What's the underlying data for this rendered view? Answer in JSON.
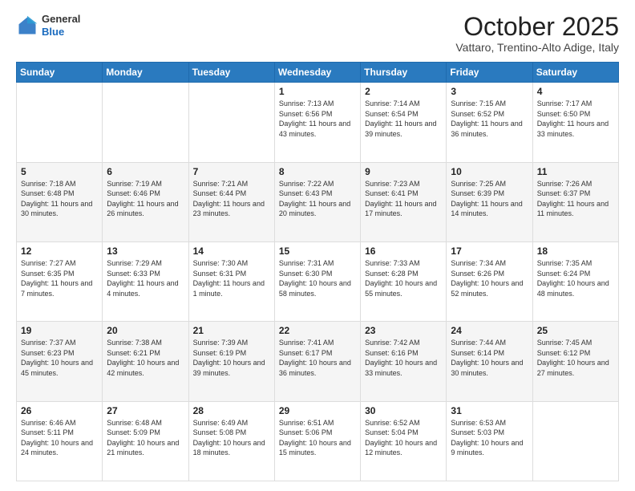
{
  "header": {
    "logo": {
      "general": "General",
      "blue": "Blue"
    },
    "month": "October 2025",
    "location": "Vattaro, Trentino-Alto Adige, Italy"
  },
  "days_of_week": [
    "Sunday",
    "Monday",
    "Tuesday",
    "Wednesday",
    "Thursday",
    "Friday",
    "Saturday"
  ],
  "weeks": [
    [
      {
        "day": "",
        "sunrise": "",
        "sunset": "",
        "daylight": ""
      },
      {
        "day": "",
        "sunrise": "",
        "sunset": "",
        "daylight": ""
      },
      {
        "day": "",
        "sunrise": "",
        "sunset": "",
        "daylight": ""
      },
      {
        "day": "1",
        "sunrise": "Sunrise: 7:13 AM",
        "sunset": "Sunset: 6:56 PM",
        "daylight": "Daylight: 11 hours and 43 minutes."
      },
      {
        "day": "2",
        "sunrise": "Sunrise: 7:14 AM",
        "sunset": "Sunset: 6:54 PM",
        "daylight": "Daylight: 11 hours and 39 minutes."
      },
      {
        "day": "3",
        "sunrise": "Sunrise: 7:15 AM",
        "sunset": "Sunset: 6:52 PM",
        "daylight": "Daylight: 11 hours and 36 minutes."
      },
      {
        "day": "4",
        "sunrise": "Sunrise: 7:17 AM",
        "sunset": "Sunset: 6:50 PM",
        "daylight": "Daylight: 11 hours and 33 minutes."
      }
    ],
    [
      {
        "day": "5",
        "sunrise": "Sunrise: 7:18 AM",
        "sunset": "Sunset: 6:48 PM",
        "daylight": "Daylight: 11 hours and 30 minutes."
      },
      {
        "day": "6",
        "sunrise": "Sunrise: 7:19 AM",
        "sunset": "Sunset: 6:46 PM",
        "daylight": "Daylight: 11 hours and 26 minutes."
      },
      {
        "day": "7",
        "sunrise": "Sunrise: 7:21 AM",
        "sunset": "Sunset: 6:44 PM",
        "daylight": "Daylight: 11 hours and 23 minutes."
      },
      {
        "day": "8",
        "sunrise": "Sunrise: 7:22 AM",
        "sunset": "Sunset: 6:43 PM",
        "daylight": "Daylight: 11 hours and 20 minutes."
      },
      {
        "day": "9",
        "sunrise": "Sunrise: 7:23 AM",
        "sunset": "Sunset: 6:41 PM",
        "daylight": "Daylight: 11 hours and 17 minutes."
      },
      {
        "day": "10",
        "sunrise": "Sunrise: 7:25 AM",
        "sunset": "Sunset: 6:39 PM",
        "daylight": "Daylight: 11 hours and 14 minutes."
      },
      {
        "day": "11",
        "sunrise": "Sunrise: 7:26 AM",
        "sunset": "Sunset: 6:37 PM",
        "daylight": "Daylight: 11 hours and 11 minutes."
      }
    ],
    [
      {
        "day": "12",
        "sunrise": "Sunrise: 7:27 AM",
        "sunset": "Sunset: 6:35 PM",
        "daylight": "Daylight: 11 hours and 7 minutes."
      },
      {
        "day": "13",
        "sunrise": "Sunrise: 7:29 AM",
        "sunset": "Sunset: 6:33 PM",
        "daylight": "Daylight: 11 hours and 4 minutes."
      },
      {
        "day": "14",
        "sunrise": "Sunrise: 7:30 AM",
        "sunset": "Sunset: 6:31 PM",
        "daylight": "Daylight: 11 hours and 1 minute."
      },
      {
        "day": "15",
        "sunrise": "Sunrise: 7:31 AM",
        "sunset": "Sunset: 6:30 PM",
        "daylight": "Daylight: 10 hours and 58 minutes."
      },
      {
        "day": "16",
        "sunrise": "Sunrise: 7:33 AM",
        "sunset": "Sunset: 6:28 PM",
        "daylight": "Daylight: 10 hours and 55 minutes."
      },
      {
        "day": "17",
        "sunrise": "Sunrise: 7:34 AM",
        "sunset": "Sunset: 6:26 PM",
        "daylight": "Daylight: 10 hours and 52 minutes."
      },
      {
        "day": "18",
        "sunrise": "Sunrise: 7:35 AM",
        "sunset": "Sunset: 6:24 PM",
        "daylight": "Daylight: 10 hours and 48 minutes."
      }
    ],
    [
      {
        "day": "19",
        "sunrise": "Sunrise: 7:37 AM",
        "sunset": "Sunset: 6:23 PM",
        "daylight": "Daylight: 10 hours and 45 minutes."
      },
      {
        "day": "20",
        "sunrise": "Sunrise: 7:38 AM",
        "sunset": "Sunset: 6:21 PM",
        "daylight": "Daylight: 10 hours and 42 minutes."
      },
      {
        "day": "21",
        "sunrise": "Sunrise: 7:39 AM",
        "sunset": "Sunset: 6:19 PM",
        "daylight": "Daylight: 10 hours and 39 minutes."
      },
      {
        "day": "22",
        "sunrise": "Sunrise: 7:41 AM",
        "sunset": "Sunset: 6:17 PM",
        "daylight": "Daylight: 10 hours and 36 minutes."
      },
      {
        "day": "23",
        "sunrise": "Sunrise: 7:42 AM",
        "sunset": "Sunset: 6:16 PM",
        "daylight": "Daylight: 10 hours and 33 minutes."
      },
      {
        "day": "24",
        "sunrise": "Sunrise: 7:44 AM",
        "sunset": "Sunset: 6:14 PM",
        "daylight": "Daylight: 10 hours and 30 minutes."
      },
      {
        "day": "25",
        "sunrise": "Sunrise: 7:45 AM",
        "sunset": "Sunset: 6:12 PM",
        "daylight": "Daylight: 10 hours and 27 minutes."
      }
    ],
    [
      {
        "day": "26",
        "sunrise": "Sunrise: 6:46 AM",
        "sunset": "Sunset: 5:11 PM",
        "daylight": "Daylight: 10 hours and 24 minutes."
      },
      {
        "day": "27",
        "sunrise": "Sunrise: 6:48 AM",
        "sunset": "Sunset: 5:09 PM",
        "daylight": "Daylight: 10 hours and 21 minutes."
      },
      {
        "day": "28",
        "sunrise": "Sunrise: 6:49 AM",
        "sunset": "Sunset: 5:08 PM",
        "daylight": "Daylight: 10 hours and 18 minutes."
      },
      {
        "day": "29",
        "sunrise": "Sunrise: 6:51 AM",
        "sunset": "Sunset: 5:06 PM",
        "daylight": "Daylight: 10 hours and 15 minutes."
      },
      {
        "day": "30",
        "sunrise": "Sunrise: 6:52 AM",
        "sunset": "Sunset: 5:04 PM",
        "daylight": "Daylight: 10 hours and 12 minutes."
      },
      {
        "day": "31",
        "sunrise": "Sunrise: 6:53 AM",
        "sunset": "Sunset: 5:03 PM",
        "daylight": "Daylight: 10 hours and 9 minutes."
      },
      {
        "day": "",
        "sunrise": "",
        "sunset": "",
        "daylight": ""
      }
    ]
  ]
}
